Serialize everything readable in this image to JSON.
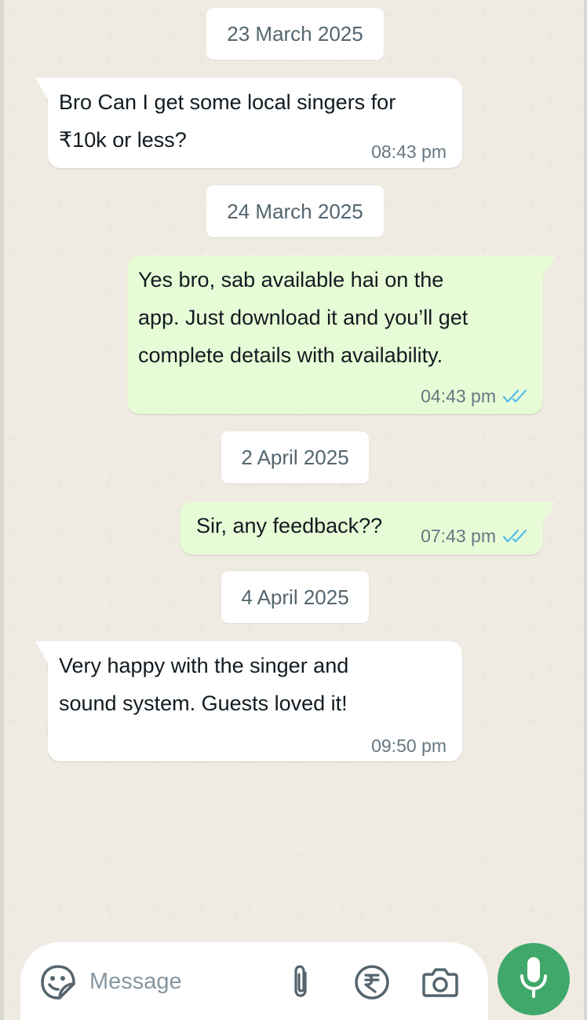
{
  "colors": {
    "chat_background": "#efeae2",
    "incoming_bubble": "#ffffff",
    "outgoing_bubble": "#e7fcd6",
    "read_ticks": "#53bdeb",
    "mic_button": "#3fa86a"
  },
  "dates": [
    "23 March 2025",
    "24 March 2025",
    "2 April 2025",
    "4 April 2025"
  ],
  "messages": [
    {
      "direction": "incoming",
      "text": " Bro Can I get some local singers for\n₹10k or less?",
      "time": "08:43 pm"
    },
    {
      "direction": "outgoing",
      "text": " Yes bro, sab available hai on the\napp. Just download it and you’ll get\ncomplete details with availability.",
      "time": "04:43 pm",
      "status": "read-ticks-icon"
    },
    {
      "direction": "outgoing",
      "text": "Sir, any feedback??",
      "time": "07:43 pm",
      "status": "read-ticks-icon"
    },
    {
      "direction": "incoming",
      "text": " Very happy with the singer and\nsound system. Guests loved it!",
      "time": "09:50 pm"
    }
  ],
  "composer": {
    "placeholder": "Message",
    "icons": [
      "sticker-icon",
      "attachment-icon",
      "rupee-payment-icon",
      "camera-icon"
    ]
  },
  "mic_icon": "microphone-icon"
}
